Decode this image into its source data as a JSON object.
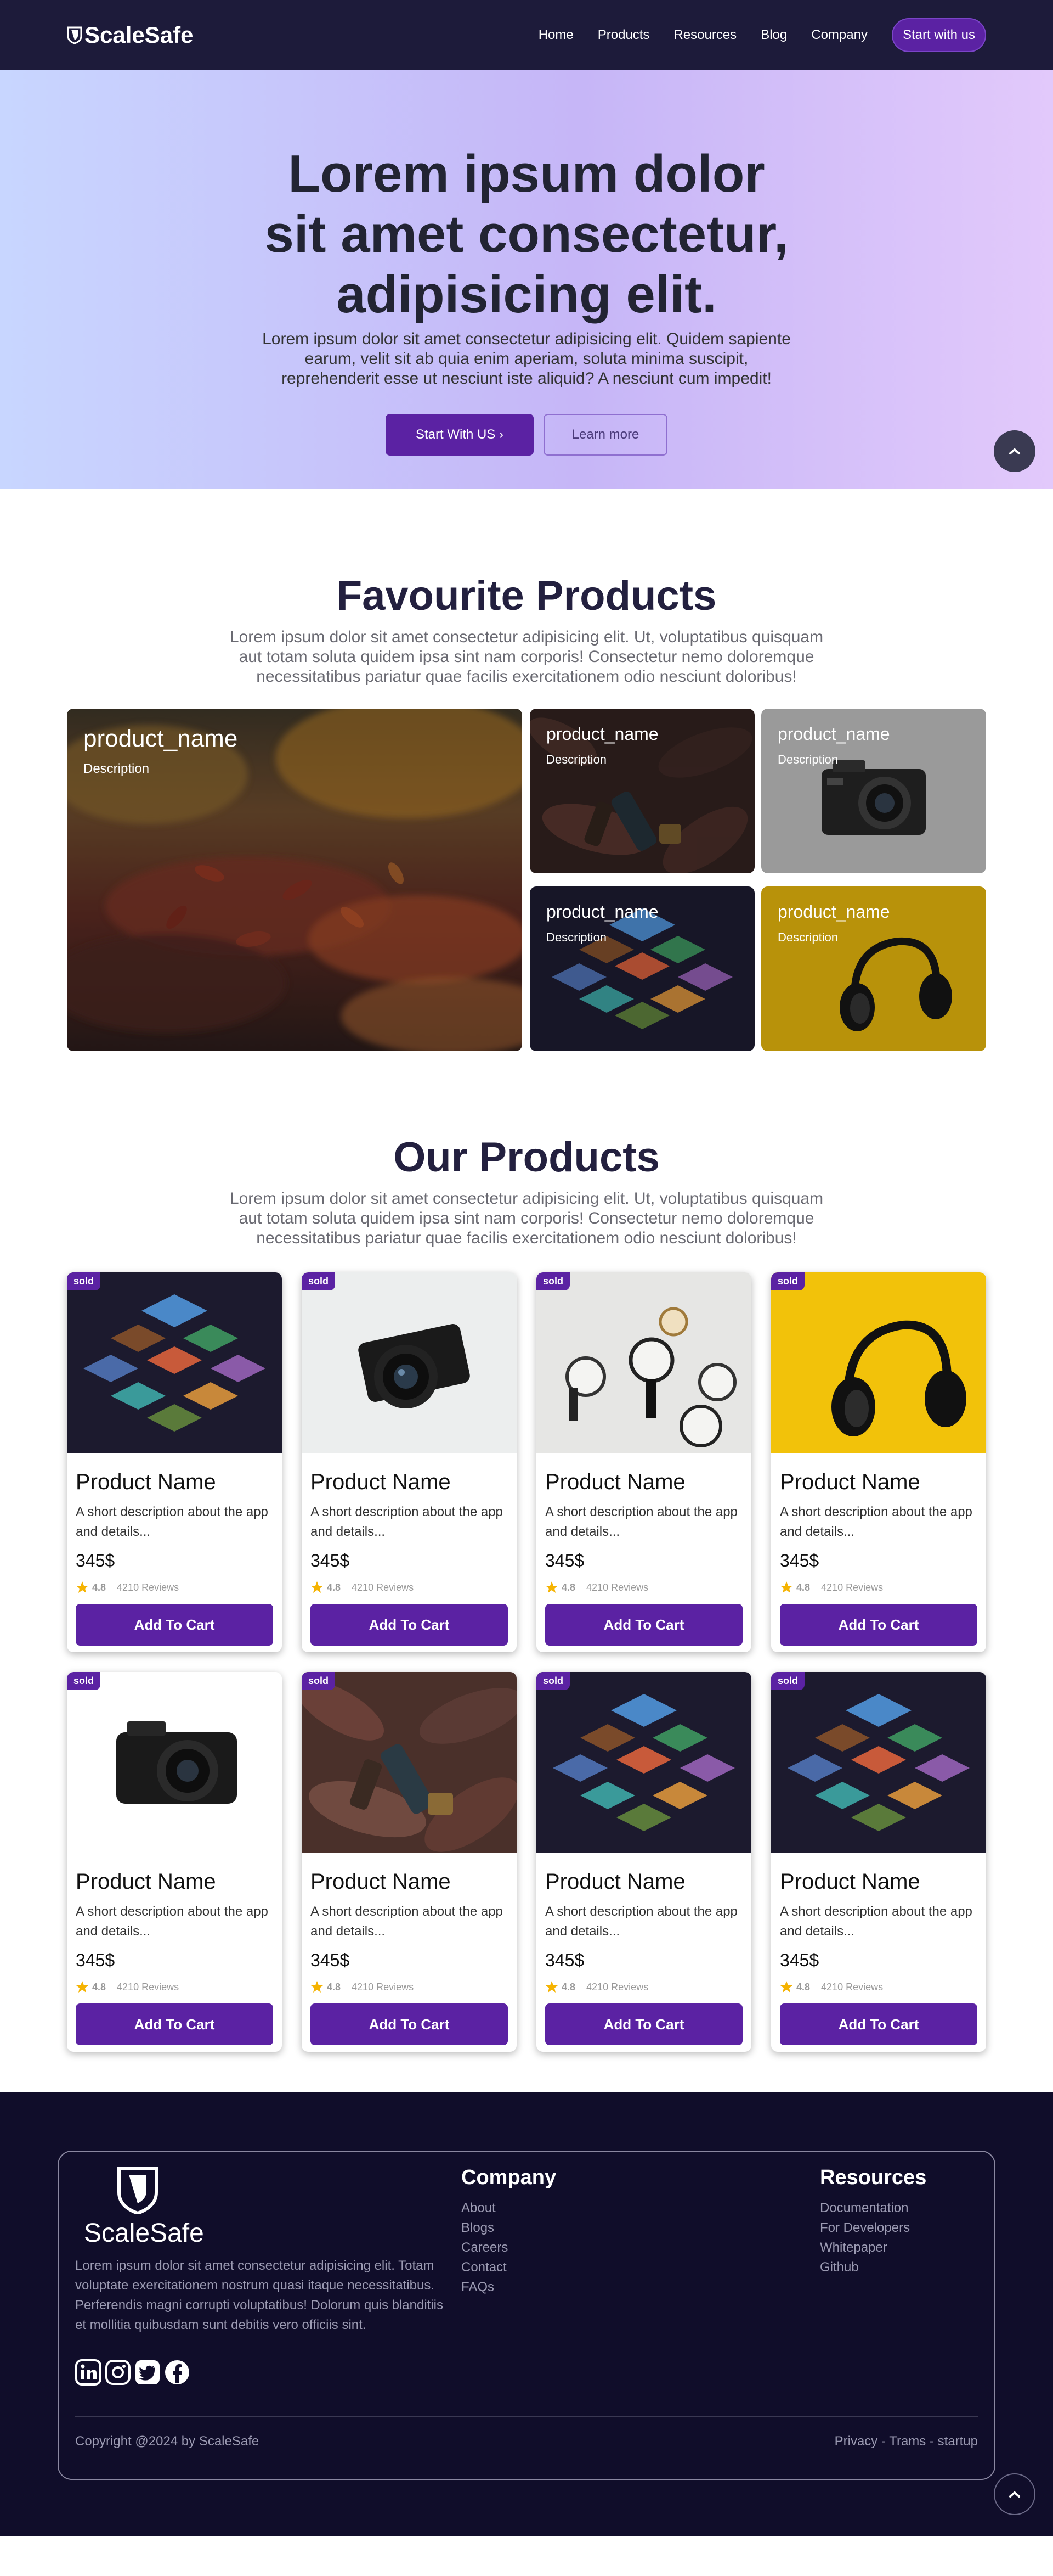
{
  "nav": {
    "brand": "ScaleSafe",
    "links": [
      "Home",
      "Products",
      "Resources",
      "Blog",
      "Company"
    ],
    "cta": "Start with us"
  },
  "hero": {
    "title": "Lorem ipsum dolor sit amet consectetur, adipisicing elit.",
    "text": "Lorem ipsum dolor sit amet consectetur adipisicing elit. Quidem sapiente earum, velit sit ab quia enim aperiam, soluta minima suscipit, reprehenderit esse ut nesciunt iste aliquid? A nesciunt cum impedit!",
    "primary_btn": "Start With US ›",
    "secondary_btn": "Learn more"
  },
  "favourites": {
    "title": "Favourite Products",
    "text": "Lorem ipsum dolor sit amet consectetur adipisicing elit. Ut, voluptatibus quisquam aut totam soluta quidem ipsa sint nam corporis! Consectetur nemo doloremque necessitatibus pariatur quae facilis exercitationem odio nesciunt doloribus!",
    "tiles": [
      {
        "name": "product_name",
        "desc": "Description",
        "image": "autumn-leaves"
      },
      {
        "name": "product_name",
        "desc": "Description",
        "image": "leaves-bottles"
      },
      {
        "name": "product_name",
        "desc": "Description",
        "image": "camera"
      },
      {
        "name": "product_name",
        "desc": "Description",
        "image": "isometric-city"
      },
      {
        "name": "product_name",
        "desc": "Description",
        "image": "headphones"
      }
    ]
  },
  "products": {
    "title": "Our Products",
    "text": "Lorem ipsum dolor sit amet consectetur adipisicing elit. Ut, voluptatibus quisquam aut totam soluta quidem ipsa sint nam corporis! Consectetur nemo doloremque necessitatibus pariatur quae facilis exercitationem odio nesciunt doloribus!",
    "items": [
      {
        "badge": "sold",
        "name": "Product Name",
        "desc": "A short description about the app and details...",
        "price": "345$",
        "rating": "4.8",
        "reviews": "4210 Reviews",
        "button": "Add To Cart",
        "image": "isometric-city"
      },
      {
        "badge": "sold",
        "name": "Product Name",
        "desc": "A short description about the app and details...",
        "price": "345$",
        "rating": "4.8",
        "reviews": "4210 Reviews",
        "button": "Add To Cart",
        "image": "dslr-camera"
      },
      {
        "badge": "sold",
        "name": "Product Name",
        "desc": "A short description about the app and details...",
        "price": "345$",
        "rating": "4.8",
        "reviews": "4210 Reviews",
        "button": "Add To Cart",
        "image": "watches"
      },
      {
        "badge": "sold",
        "name": "Product Name",
        "desc": "A short description about the app and details...",
        "price": "345$",
        "rating": "4.8",
        "reviews": "4210 Reviews",
        "button": "Add To Cart",
        "image": "headphones-yellow"
      },
      {
        "badge": "sold",
        "name": "Product Name",
        "desc": "A short description about the app and details...",
        "price": "345$",
        "rating": "4.8",
        "reviews": "4210 Reviews",
        "button": "Add To Cart",
        "image": "compact-camera"
      },
      {
        "badge": "sold",
        "name": "Product Name",
        "desc": "A short description about the app and details...",
        "price": "345$",
        "rating": "4.8",
        "reviews": "4210 Reviews",
        "button": "Add To Cart",
        "image": "leaves-bottles"
      },
      {
        "badge": "sold",
        "name": "Product Name",
        "desc": "A short description about the app and details...",
        "price": "345$",
        "rating": "4.8",
        "reviews": "4210 Reviews",
        "button": "Add To Cart",
        "image": "isometric-city"
      },
      {
        "badge": "sold",
        "name": "Product Name",
        "desc": "A short description about the app and details...",
        "price": "345$",
        "rating": "4.8",
        "reviews": "4210 Reviews",
        "button": "Add To Cart",
        "image": "isometric-city"
      }
    ]
  },
  "footer": {
    "brand": "ScaleSafe",
    "about": "Lorem ipsum dolor sit amet consectetur adipisicing elit. Totam voluptate exercitationem nostrum quasi itaque necessitatibus. Perferendis magni corrupti voluptatibus! Dolorum quis blanditiis et mollitia quibusdam sunt debitis vero officiis sint.",
    "socials": [
      "linkedin-icon",
      "instagram-icon",
      "twitter-icon",
      "facebook-icon"
    ],
    "company": {
      "title": "Company",
      "links": [
        "About",
        "Blogs",
        "Careers",
        "Contact",
        "FAQs"
      ]
    },
    "resources": {
      "title": "Resources",
      "links": [
        "Documentation",
        "For Developers",
        "Whitepaper",
        "Github"
      ]
    },
    "copyright": "Copyright @2024 by ScaleSafe",
    "legal": "Privacy - Trams - startup"
  },
  "colors": {
    "accent": "#5b22a3",
    "nav_bg": "#1d1b3a",
    "footer_bg": "#100d2a",
    "star": "#f5b301"
  }
}
